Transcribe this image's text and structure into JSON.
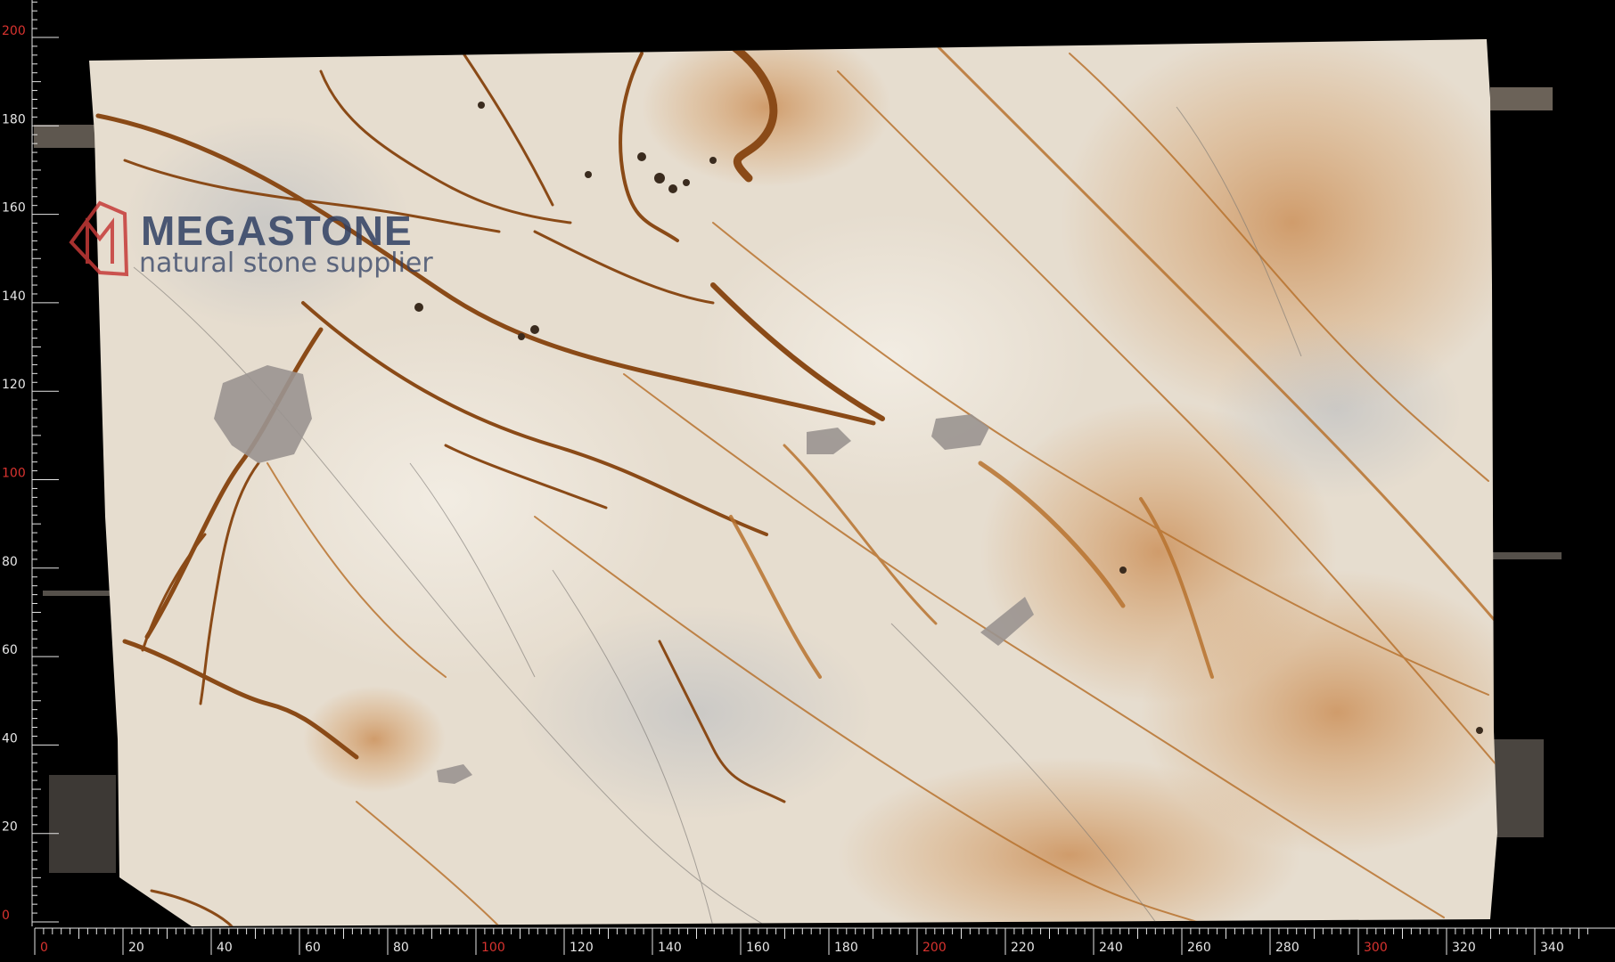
{
  "watermark": {
    "brand": "MEGASTONE",
    "tagline": "natural stone supplier",
    "logo_letters": "MG",
    "brand_color": "#2f3f63",
    "logo_color": "#c63a38"
  },
  "ruler": {
    "x_labels": [
      {
        "text": "0",
        "major": true
      },
      {
        "text": "20",
        "major": false
      },
      {
        "text": "40",
        "major": false
      },
      {
        "text": "60",
        "major": false
      },
      {
        "text": "80",
        "major": false
      },
      {
        "text": "100",
        "major": true
      },
      {
        "text": "120",
        "major": false
      },
      {
        "text": "140",
        "major": false
      },
      {
        "text": "160",
        "major": false
      },
      {
        "text": "180",
        "major": false
      },
      {
        "text": "200",
        "major": true
      },
      {
        "text": "220",
        "major": false
      },
      {
        "text": "240",
        "major": false
      },
      {
        "text": "260",
        "major": false
      },
      {
        "text": "280",
        "major": false
      },
      {
        "text": "300",
        "major": true
      },
      {
        "text": "320",
        "major": false
      },
      {
        "text": "340",
        "major": false
      }
    ],
    "y_labels": [
      {
        "text": "0",
        "major": true
      },
      {
        "text": "20",
        "major": false
      },
      {
        "text": "40",
        "major": false
      },
      {
        "text": "60",
        "major": false
      },
      {
        "text": "80",
        "major": false
      },
      {
        "text": "100",
        "major": true
      },
      {
        "text": "120",
        "major": false
      },
      {
        "text": "140",
        "major": false
      },
      {
        "text": "160",
        "major": false
      },
      {
        "text": "180",
        "major": false
      },
      {
        "text": "200",
        "major": true
      }
    ],
    "major_color": "#d9332f",
    "minor_color": "#e6e6e6"
  },
  "slab": {
    "base_color": "#e6ddcf",
    "vein_color": "#8a4a17",
    "stain_color": "#c8864a",
    "crystal_color": "#9a9490"
  }
}
